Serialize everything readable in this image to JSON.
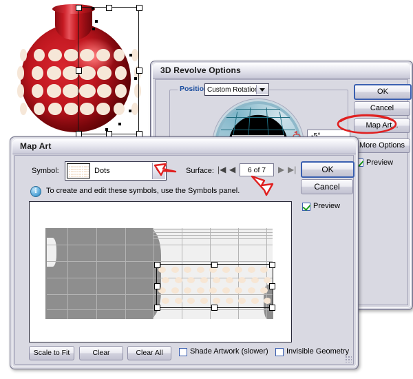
{
  "artwork": {
    "name": "polka-dot-vase",
    "colors": {
      "body_red": "#c0171f",
      "dot_cream": "#f6e7d8",
      "highlight": "#ff8080"
    }
  },
  "revolve_dialog": {
    "title": "3D Revolve Options",
    "position_group": {
      "label": "Position:",
      "selected": "Custom Rotation"
    },
    "rotation_value": "-5°",
    "buttons": {
      "ok": "OK",
      "cancel": "Cancel",
      "map_art": "Map Art...",
      "more_options": "More Options"
    },
    "preview": {
      "label": "Preview",
      "checked": true
    }
  },
  "map_art_dialog": {
    "title": "Map Art",
    "symbol": {
      "label": "Symbol:",
      "value": "Dots"
    },
    "surface": {
      "label": "Surface:",
      "value": "6 of 7",
      "first_icon": "first-surface-icon",
      "prev_icon": "previous-surface-icon",
      "next_icon": "next-surface-icon",
      "last_icon": "last-surface-icon"
    },
    "hint": "To create and edit these symbols, use the Symbols panel.",
    "buttons": {
      "ok": "OK",
      "cancel": "Cancel",
      "scale_to_fit": "Scale to Fit",
      "clear": "Clear",
      "clear_all": "Clear All"
    },
    "preview": {
      "label": "Preview",
      "checked": true
    },
    "shade_artwork": {
      "label": "Shade Artwork (slower)",
      "checked": false
    },
    "invisible_geometry": {
      "label": "Invisible Geometry",
      "checked": false
    }
  },
  "annotations": {
    "map_art_circle": {
      "name": "map-art-highlight-ellipse",
      "color": "#e02020"
    },
    "arrow_symbol": {
      "name": "symbol-dropdown-arrow-annotation",
      "color": "#e02020"
    },
    "arrow_surface": {
      "name": "surface-next-arrow-annotation",
      "color": "#e02020"
    }
  }
}
